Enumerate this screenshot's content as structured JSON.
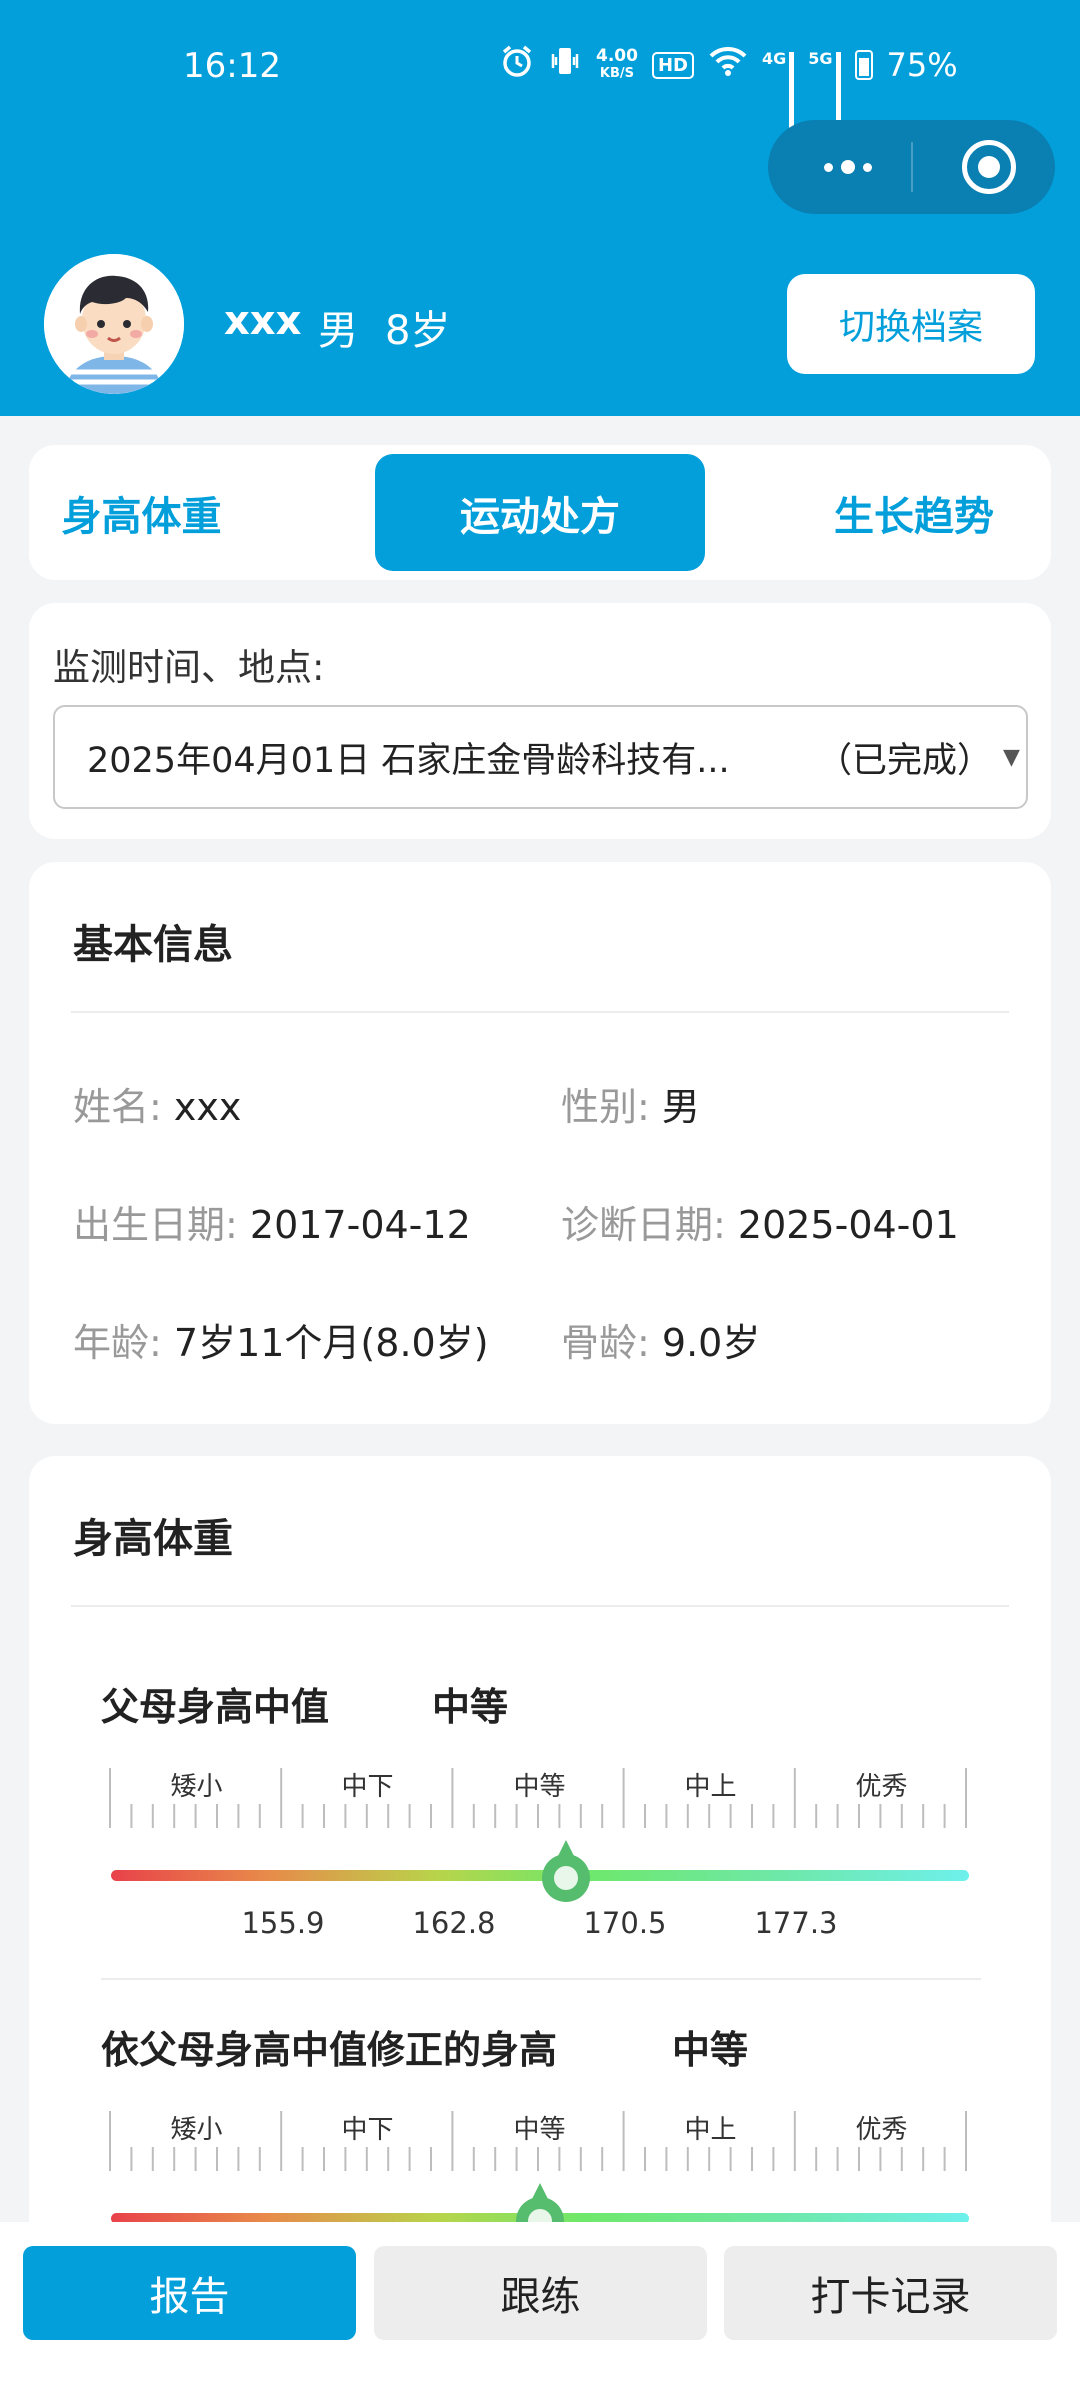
{
  "status_bar": {
    "time": "16:12",
    "speed_value": "4.00",
    "speed_unit": "KB/S",
    "hd_label": "HD",
    "net1_label": "4G",
    "net2_label": "5G",
    "battery": "75%"
  },
  "profile": {
    "name": "xxx",
    "gender": "男",
    "age": "8岁",
    "switch_label": "切换档案"
  },
  "tabs": [
    {
      "label": "身高体重",
      "active": false
    },
    {
      "label": "运动处方",
      "active": true
    },
    {
      "label": "生长趋势",
      "active": false
    }
  ],
  "monitor": {
    "label": "监测时间、地点:",
    "selected": "2025年04月01日 石家庄金骨龄科技有...",
    "status": "（已完成）"
  },
  "basic_info": {
    "title": "基本信息",
    "name_label": "姓名:",
    "name_value": "xxx",
    "gender_label": "性别:",
    "gender_value": "男",
    "birth_label": "出生日期:",
    "birth_value": "2017-04-12",
    "diag_label": "诊断日期:",
    "diag_value": "2025-04-01",
    "age_label": "年龄:",
    "age_value": "7岁11个月(8.0岁)",
    "bone_label": "骨龄:",
    "bone_value": "9.0岁"
  },
  "height_weight": {
    "title": "身高体重",
    "scales": [
      {
        "title": "父母身高中值",
        "level": "中等",
        "categories": [
          "矮小",
          "中下",
          "中等",
          "中上",
          "优秀"
        ],
        "boundaries": [
          "155.9",
          "162.8",
          "170.5",
          "177.3"
        ],
        "marker_fraction": 0.53
      },
      {
        "title": "依父母身高中值修正的身高",
        "level": "中等",
        "categories": [
          "矮小",
          "中下",
          "中等",
          "中上",
          "优秀"
        ],
        "marker_fraction": 0.5
      }
    ]
  },
  "bottom_nav": {
    "report": "报告",
    "follow": "跟练",
    "checkin": "打卡记录"
  },
  "colors": {
    "primary": "#039fdb",
    "marker": "#56bd6e"
  }
}
